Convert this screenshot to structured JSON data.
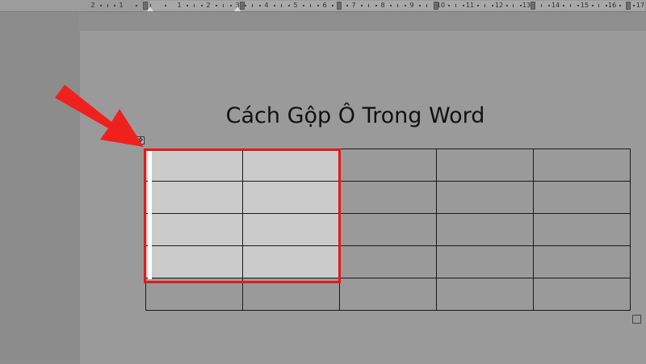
{
  "ruler": {
    "labels": [
      "2",
      "1",
      "1",
      "2",
      "3",
      "4",
      "5",
      "6",
      "7",
      "8",
      "9",
      "10",
      "11",
      "12",
      "13",
      "14",
      "15",
      "16",
      "17"
    ]
  },
  "document": {
    "title": "Cách Gộp Ô Trong Word",
    "table": {
      "rows": 5,
      "columns": 5,
      "cells": [
        [
          "",
          "",
          "",
          "",
          ""
        ],
        [
          "",
          "",
          "",
          "",
          ""
        ],
        [
          "",
          "",
          "",
          "",
          ""
        ],
        [
          "",
          "",
          "",
          "",
          ""
        ],
        [
          "",
          "",
          "",
          "",
          ""
        ]
      ],
      "selected_rows": 4,
      "selected_columns": 2
    },
    "move_handle_icon": "table-move-icon",
    "resize_handle_icon": "table-resize-icon"
  },
  "annotation": {
    "arrow_icon": "red-arrow-icon",
    "highlight_color": "#e21a1a",
    "arrow_color": "#f0201e"
  },
  "colors": {
    "page_background": "#9a9a9a",
    "selection_fill": "#cbcbcb",
    "table_border": "#1a1a1a"
  }
}
